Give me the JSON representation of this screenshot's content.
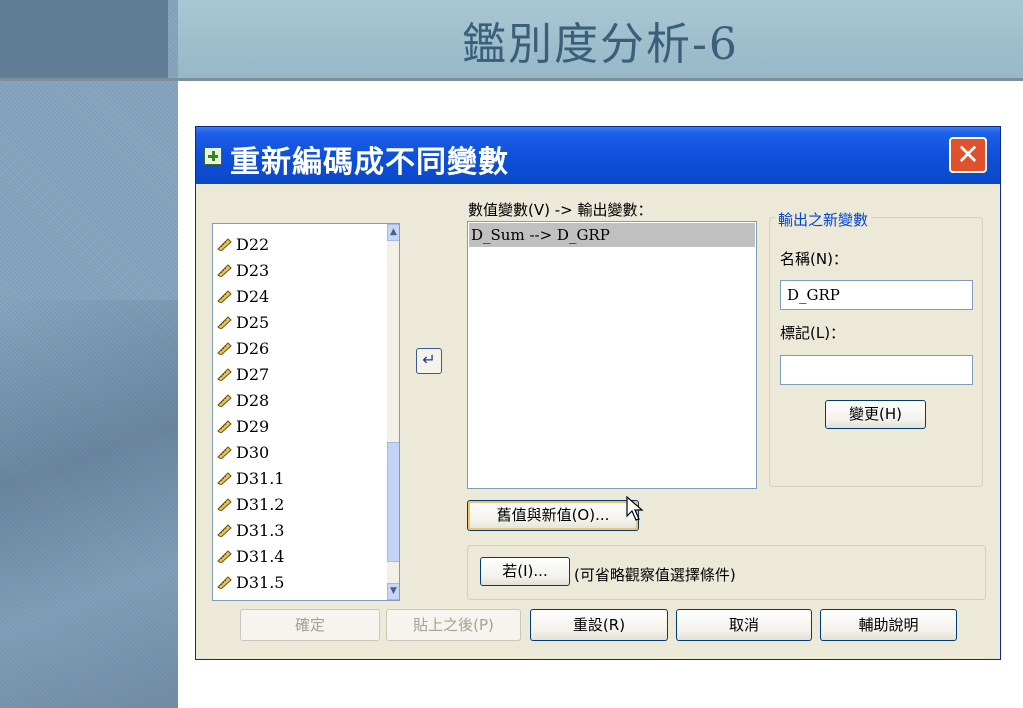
{
  "slide": {
    "title": "鑑別度分析-6"
  },
  "dialog": {
    "title": "重新編碼成不同變數",
    "variables": [
      "D22",
      "D23",
      "D24",
      "D25",
      "D26",
      "D27",
      "D28",
      "D29",
      "D30",
      "D31.1",
      "D31.2",
      "D31.3",
      "D31.4",
      "D31.5"
    ],
    "variable_icon": "ruler-icon",
    "mapping_label": "數值變數(V) -> 輸出變數：",
    "mappings": [
      "D_Sum --> D_GRP"
    ],
    "output_group": {
      "legend": "輸出之新變數",
      "name_label": "名稱(N)：",
      "name_value": "D_GRP",
      "label_label": "標記(L)：",
      "label_value": "",
      "change_button": "變更(H)"
    },
    "old_new_button": "舊值與新值(O)...",
    "if_button": "若(I)...",
    "if_note": "(可省略觀察值選擇條件)",
    "buttons": {
      "ok": "確定",
      "paste": "貼上之後(P)",
      "reset": "重設(R)",
      "cancel": "取消",
      "help": "輔助說明"
    },
    "colors": {
      "titlebar": "#0b48c8",
      "close": "#e0512d",
      "dialog_bg": "#ece9d8",
      "group_legend": "#0046d5"
    }
  }
}
